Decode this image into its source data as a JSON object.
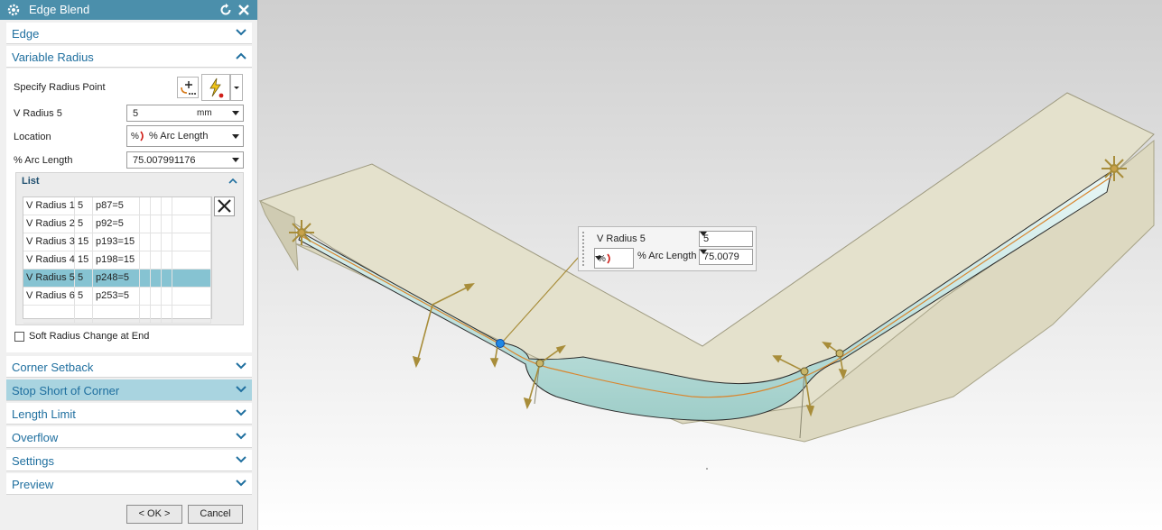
{
  "dialog": {
    "title": "Edge Blend",
    "sections": {
      "edge": "Edge",
      "variable_radius": "Variable Radius",
      "corner_setback": "Corner Setback",
      "stop_short": "Stop Short of Corner",
      "length_limit": "Length Limit",
      "overflow": "Overflow",
      "settings": "Settings",
      "preview": "Preview"
    },
    "variable_radius": {
      "specify_point_label": "Specify Radius Point",
      "v_radius_label": "V Radius 5",
      "v_radius_value": "5",
      "v_radius_unit": "mm",
      "location_label": "Location",
      "location_value": "% Arc Length",
      "arc_length_label": "% Arc Length",
      "arc_length_value": "75.007991176"
    },
    "list": {
      "title": "List",
      "rows": [
        {
          "name": "V Radius 1",
          "radius": "5",
          "expr": "p87=5"
        },
        {
          "name": "V Radius 2",
          "radius": "5",
          "expr": "p92=5"
        },
        {
          "name": "V Radius 3",
          "radius": "15",
          "expr": "p193=15"
        },
        {
          "name": "V Radius 4",
          "radius": "15",
          "expr": "p198=15"
        },
        {
          "name": "V Radius 5",
          "radius": "5",
          "expr": "p248=5"
        },
        {
          "name": "V Radius 6",
          "radius": "5",
          "expr": "p253=5"
        }
      ],
      "selected_index": 4
    },
    "soft_radius_label": "Soft Radius Change at End",
    "soft_radius_checked": false,
    "ok_label": "< OK >",
    "cancel_label": "Cancel"
  },
  "callout": {
    "v_radius_label": "V Radius 5",
    "v_radius_value": "5",
    "arc_length_label": "% Arc Length",
    "arc_length_value": "75.0079"
  },
  "colors": {
    "title_bar": "#4b8fab",
    "section_text": "#1f6f9f",
    "highlight_section": "#a9d4e0",
    "selected_row": "#86c3d2",
    "sheet_fill": "#e4e1cc",
    "blend_fill": "#cfe9e6",
    "handle": "#a88d3a",
    "point_marker": "#1e88e5"
  },
  "icons": [
    "gear-icon",
    "reset-icon",
    "close-icon",
    "chevron-down-icon",
    "chevron-up-icon",
    "point-dialog-icon",
    "inferred-point-icon",
    "arc-length-icon",
    "delete-icon"
  ]
}
